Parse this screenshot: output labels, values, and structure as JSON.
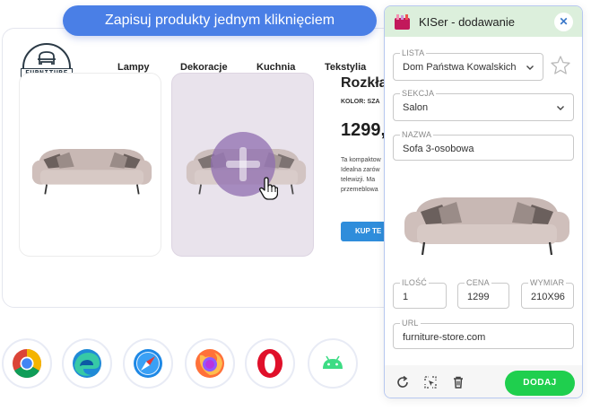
{
  "headline": "Zapisuj produkty jednym kliknięciem",
  "shop": {
    "logo_text": "FURNITURE",
    "nav": [
      "Lampy",
      "Dekoracje",
      "Kuchnia",
      "Tekstylia"
    ],
    "product_title": "Rozkła",
    "color_label": "KOLOR: SZA",
    "price": "1299,",
    "description": [
      "Ta kompaktow",
      "Idealna zarów",
      "telewizji. Ma",
      "przemeblowa"
    ],
    "buy_button": "KUP TE"
  },
  "browsers": [
    "chrome-icon",
    "edge-icon",
    "safari-icon",
    "firefox-icon",
    "opera-icon",
    "android-icon"
  ],
  "popup": {
    "title": "KISer - dodawanie",
    "close": "✕",
    "lista": {
      "label": "LISTA",
      "value": "Dom Państwa Kowalskich"
    },
    "sekcja": {
      "label": "SEKCJA",
      "value": "Salon"
    },
    "nazwa": {
      "label": "NAZWA",
      "value": "Sofa 3-osobowa"
    },
    "ilosc": {
      "label": "ILOŚĆ",
      "value": "1"
    },
    "cena": {
      "label": "CENA",
      "value": "1299"
    },
    "wymiar": {
      "label": "WYMIAR",
      "value": "210X96"
    },
    "url": {
      "label": "URL",
      "value": "furniture-store.com"
    },
    "add_button": "DODAJ"
  },
  "colors": {
    "headline_bg": "#4a7fe6",
    "popup_header": "#dcefdc",
    "add_button": "#1fcf4e",
    "buy_button": "#2f8ddb",
    "overlay": "#8f6eb0"
  }
}
